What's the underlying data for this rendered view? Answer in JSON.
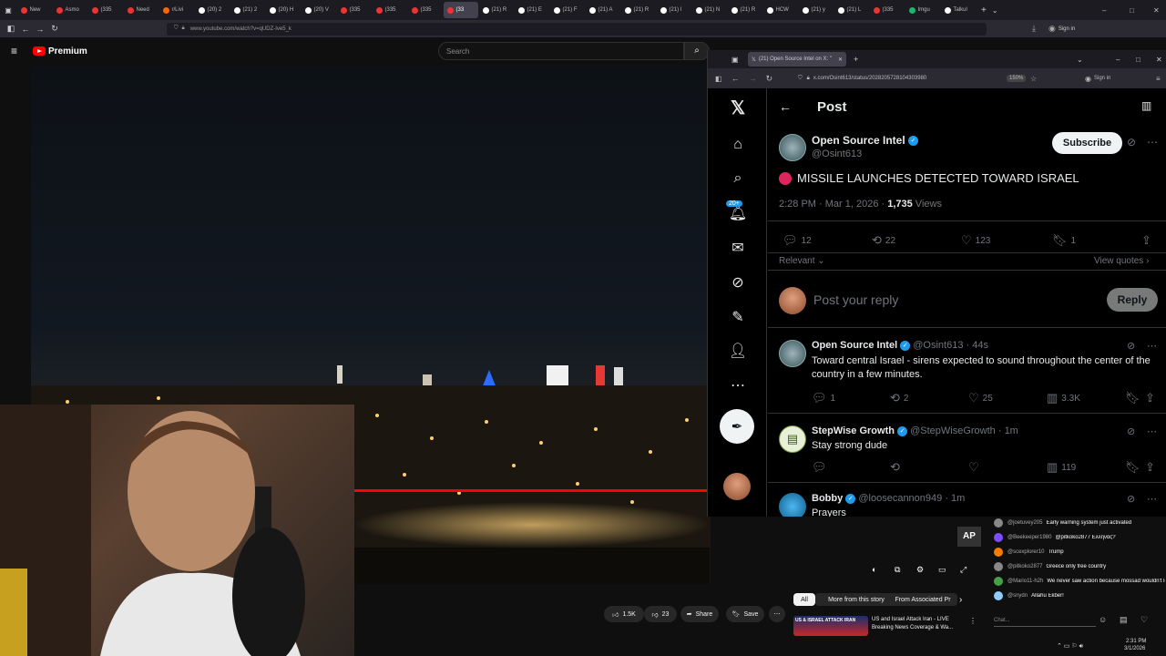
{
  "browser": {
    "tabs": [
      {
        "label": "New",
        "color": "#e33"
      },
      {
        "label": "Asmo",
        "color": "#e33"
      },
      {
        "label": "(335",
        "color": "#e33"
      },
      {
        "label": "Need",
        "color": "#e33"
      },
      {
        "label": "r/Livi",
        "color": "#f60"
      },
      {
        "label": "(20) 2",
        "color": "#fff"
      },
      {
        "label": "(21) 2",
        "color": "#fff"
      },
      {
        "label": "(20) H",
        "color": "#fff"
      },
      {
        "label": "(20) V",
        "color": "#fff"
      },
      {
        "label": "(335",
        "color": "#e33"
      },
      {
        "label": "(335",
        "color": "#e33"
      },
      {
        "label": "(335",
        "color": "#e33"
      },
      {
        "label": "(33",
        "color": "#e33"
      },
      {
        "label": "(21) R",
        "color": "#fff"
      },
      {
        "label": "(21) E",
        "color": "#fff"
      },
      {
        "label": "(21) F",
        "color": "#fff"
      },
      {
        "label": "(21) A",
        "color": "#fff"
      },
      {
        "label": "(21) R",
        "color": "#fff"
      },
      {
        "label": "(21) I",
        "color": "#fff"
      },
      {
        "label": "(21) N",
        "color": "#fff"
      },
      {
        "label": "(21) R",
        "color": "#fff"
      },
      {
        "label": "HCW",
        "color": "#fff"
      },
      {
        "label": "(21) y",
        "color": "#fff"
      },
      {
        "label": "(21) L",
        "color": "#fff"
      },
      {
        "label": "(335",
        "color": "#e33"
      },
      {
        "label": "Imgu",
        "color": "#1bb76e"
      },
      {
        "label": "Talkul",
        "color": "#fff"
      }
    ],
    "url": "www.youtube.com/watch?v=qUDZ-Ive5_k",
    "signin": "Sign in"
  },
  "youtube": {
    "logo": "Premium",
    "search_placeholder": "Search",
    "ap_badge": "AP",
    "likes": "1.5K",
    "dislikes": "23",
    "share": "Share",
    "save": "Save",
    "chips": [
      "All",
      "More from this story",
      "From Associated Pr"
    ],
    "rec_thumb_text": "US & ISRAEL ATTACK IRAN",
    "rec_title": "US and Israel Attack Iran - LIVE Breaking News Coverage & Wa..."
  },
  "chat": {
    "messages": [
      {
        "user": "@joetuvey205",
        "text": "Early warning system just activated",
        "color": "#888"
      },
      {
        "user": "@Beekeeper1980",
        "text": "@pitkoko2877 Ελληνας?",
        "color": "#7c4dff"
      },
      {
        "user": "@scexplorer10",
        "text": "Trump",
        "color": "#f57c00"
      },
      {
        "user": "@pitkoko2877",
        "text": "Greece only free country",
        "color": "#888"
      },
      {
        "user": "@Mario11-h2h",
        "text": "We never saw action because mossad wouldn't let us see",
        "color": "#43a047"
      },
      {
        "user": "@snydn",
        "text": "Allahu Ekber!",
        "color": "#90caf9"
      }
    ],
    "input_placeholder": "Chat..."
  },
  "xwindow": {
    "tab_title": "(21) Open Source Intel on X: \"",
    "url": "x.com/Osint613/status/2028205728104303980",
    "zoom": "150%",
    "signin": "Sign in",
    "header": "Post",
    "notification_badge": "20+",
    "post": {
      "author": "Open Source Intel",
      "handle": "@Osint613",
      "subscribe": "Subscribe",
      "text": "MISSILE LAUNCHES DETECTED TOWARD ISRAEL",
      "time": "2:28 PM · Mar 1, 2026 · ",
      "views_count": "1,735",
      "views_label": " Views",
      "replies": "12",
      "reposts": "22",
      "likes": "123",
      "bookmarks": "1",
      "sort": "Relevant",
      "view_quotes": "View quotes",
      "reply_placeholder": "Post your reply",
      "reply_button": "Reply"
    },
    "replies": [
      {
        "author": "Open Source Intel",
        "handle": "@Osint613 · 44s",
        "text": "Toward central Israel - sirens expected to sound throughout the center of the country in a few minutes.",
        "replies": "1",
        "reposts": "2",
        "likes": "25",
        "views": "3.3K"
      },
      {
        "author": "StepWise Growth",
        "handle": "@StepWiseGrowth · 1m",
        "text": "Stay strong dude",
        "replies": "",
        "reposts": "",
        "likes": "",
        "views": "119"
      },
      {
        "author": "Bobby",
        "handle": "@loosecannon949 · 1m",
        "text": "Prayers"
      }
    ]
  },
  "taskbar": {
    "time": "2:31 PM",
    "date": "3/1/2026"
  }
}
